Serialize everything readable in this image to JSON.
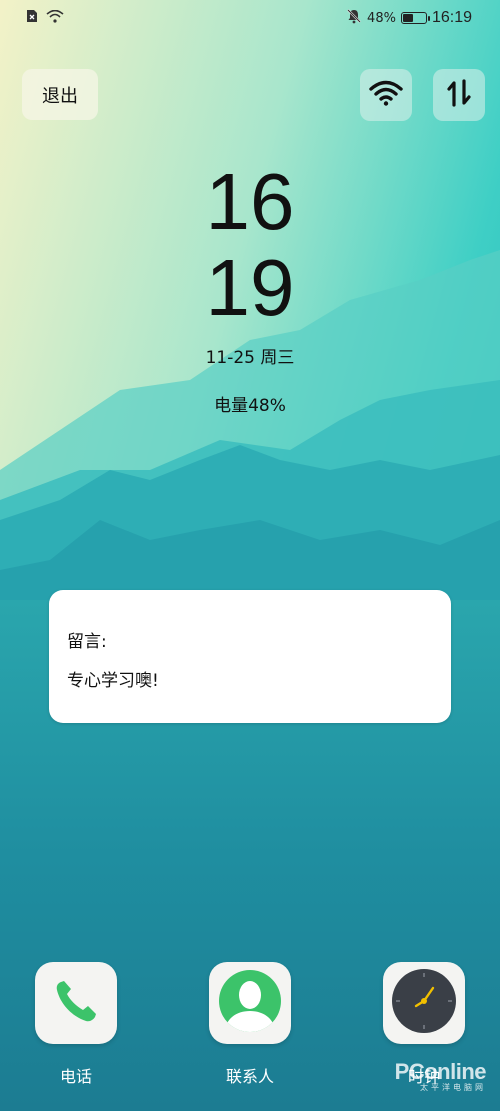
{
  "status_bar": {
    "battery_percent": "48%",
    "battery_level": 0.48,
    "time": "16:19"
  },
  "toolbar": {
    "exit_label": "退出"
  },
  "clock": {
    "hours": "16",
    "minutes": "19",
    "date": "11-25 周三",
    "battery_text": "电量48%"
  },
  "note": {
    "label": "留言:",
    "message": "专心学习噢!"
  },
  "dock": [
    {
      "label": "电话",
      "icon": "phone-icon"
    },
    {
      "label": "联系人",
      "icon": "contacts-icon"
    },
    {
      "label": "时钟",
      "icon": "clock-icon"
    }
  ],
  "watermark": {
    "brand": "PConline",
    "sub": "太平洋电脑网"
  },
  "colors": {
    "accent_green": "#3cc36a",
    "clock_face": "#3a3f47",
    "clock_hand": "#f2c000"
  }
}
